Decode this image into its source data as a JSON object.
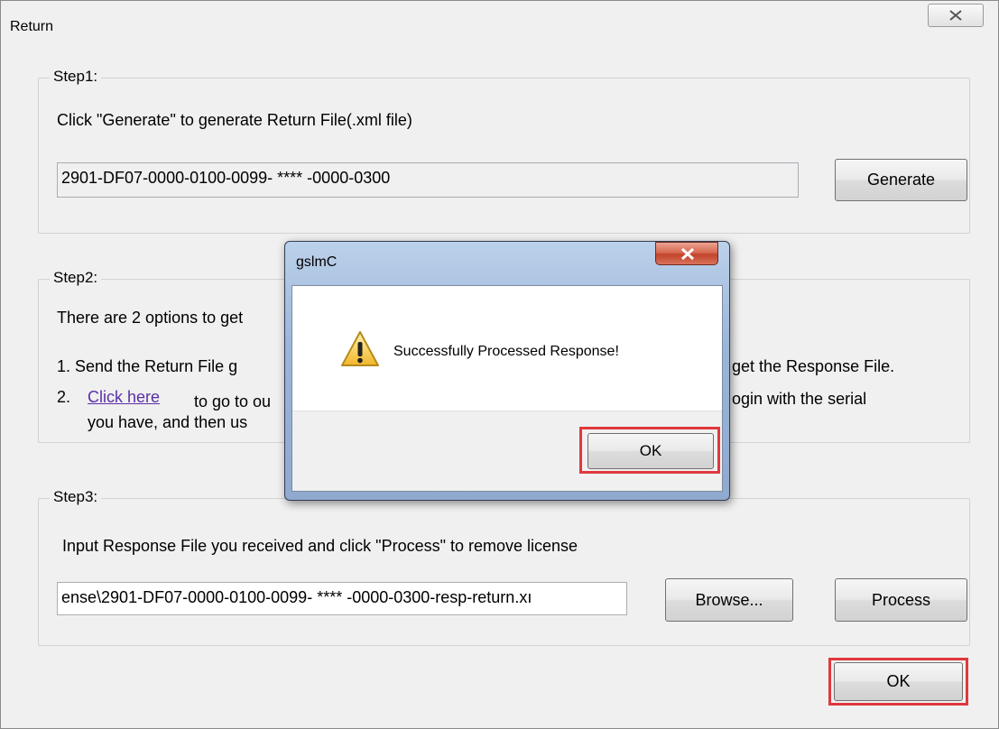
{
  "window": {
    "title": "Return"
  },
  "step1": {
    "legend": "Step1:",
    "instruction": "Click \"Generate\" to generate Return File(.xml file)",
    "serial_value": "2901-DF07-0000-0100-0099- **** -0000-0300",
    "generate_label": "Generate"
  },
  "step2": {
    "legend": "Step2:",
    "intro": "There are 2 options to get",
    "option1_prefix": "1.  Send the Return File g",
    "option1_suffix": "get the Response File.",
    "option2_number": "2.",
    "option2_link": "Click here",
    "option2_prefix": "to go to ou",
    "option2_suffix": "ogin with the serial",
    "option2_line2": "you have, and then us"
  },
  "step3": {
    "legend": "Step3:",
    "instruction": "Input Response File you received and click \"Process\" to remove license",
    "path_value": "ense\\2901-DF07-0000-0100-0099- **** -0000-0300-resp-return.xı",
    "browse_label": "Browse...",
    "process_label": "Process"
  },
  "footer": {
    "ok_label": "OK"
  },
  "dialog": {
    "title": "gslmC",
    "message": "Successfully Processed Response!",
    "ok_label": "OK",
    "icon": "warning-icon"
  },
  "colors": {
    "highlight": "#e0383e",
    "link": "#5b2fa6"
  }
}
